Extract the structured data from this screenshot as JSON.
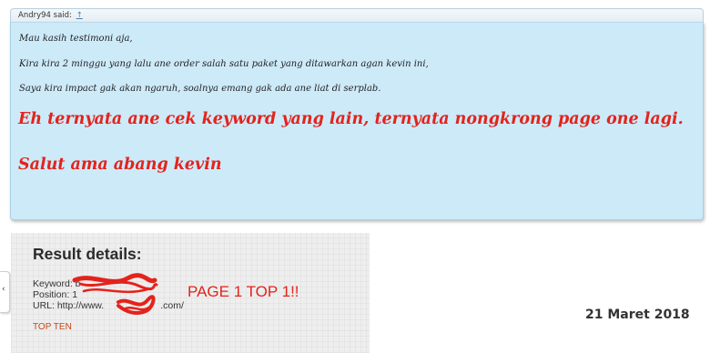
{
  "quote": {
    "author_line": "Andry94 said:",
    "jump_icon": "arrow-up-icon",
    "jump_glyph": "↑",
    "lines": [
      "Mau kasih testimoni aja,",
      "Kira kira 2 minggu yang lalu ane order salah satu paket yang ditawarkan agan kevin ini,",
      "Saya kira impact gak akan ngaruh, soalnya emang gak ada ane liat di serplab."
    ],
    "highlight_lines": [
      "Eh ternyata ane cek keyword yang lain, ternyata nongkrong page one lagi.",
      "Salut ama abang kevin"
    ],
    "colors": {
      "background": "#cdeaf9",
      "highlight": "#e3231c"
    }
  },
  "side_tab": {
    "glyph": "‹"
  },
  "result_image": {
    "title": "Result details:",
    "keyword_label": "Keyword: b",
    "position_label": "Position: 1",
    "url_label": "URL: http://www.",
    "url_suffix": ".com/",
    "top_ten": "TOP TEN",
    "page_top": "PAGE 1 TOP 1!!"
  },
  "date": "21 Maret 2018"
}
